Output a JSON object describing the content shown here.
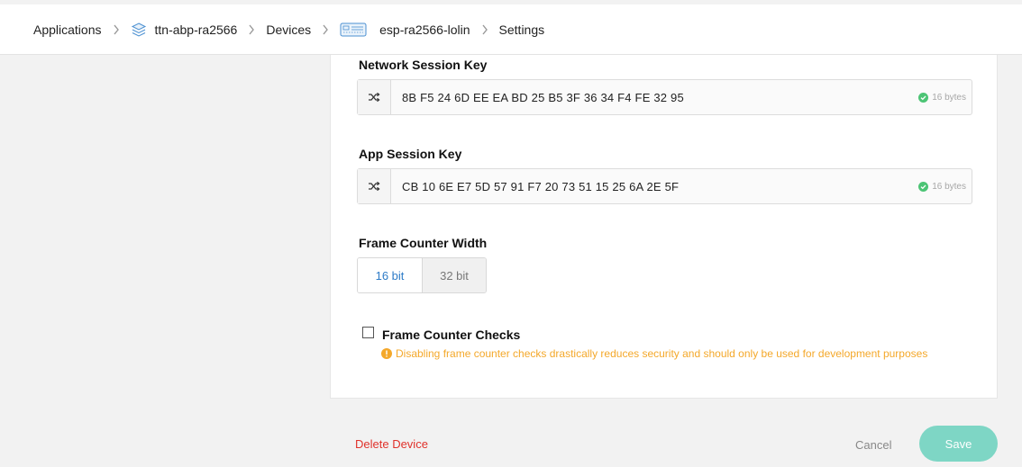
{
  "breadcrumb": {
    "applications": "Applications",
    "application": "ttn-abp-ra2566",
    "devices": "Devices",
    "device": "esp-ra2566-lolin",
    "settings": "Settings"
  },
  "network_session_key": {
    "label": "Network Session Key",
    "value": "8B  F5  24  6D  EE  EA  BD  25  B5  3F  36  34  F4  FE  32  95",
    "length": "16 bytes"
  },
  "app_session_key": {
    "label": "App Session Key",
    "value": "CB  10  6E  E7  5D  57  91  F7  20  73  51  15  25  6A  2E  5F",
    "length": "16 bytes"
  },
  "frame_counter_width": {
    "label": "Frame Counter Width",
    "options": [
      "16 bit",
      "32 bit"
    ],
    "selected": "16 bit"
  },
  "frame_counter_checks": {
    "label": "Frame Counter Checks",
    "checked": false,
    "warning": "Disabling frame counter checks drastically reduces security and should only be used for development purposes"
  },
  "actions": {
    "delete": "Delete Device",
    "cancel": "Cancel",
    "save": "Save"
  },
  "colors": {
    "accent": "#2d7bc7",
    "danger": "#e0322b",
    "warning": "#f4a82a",
    "save": "#7ed6c5",
    "ok": "#4cc475"
  },
  "icons": {
    "shuffle": "shuffle-icon",
    "check": "check-circle-icon",
    "warning": "warning-circle-icon",
    "application": "layers-icon",
    "device": "device-board-icon"
  }
}
